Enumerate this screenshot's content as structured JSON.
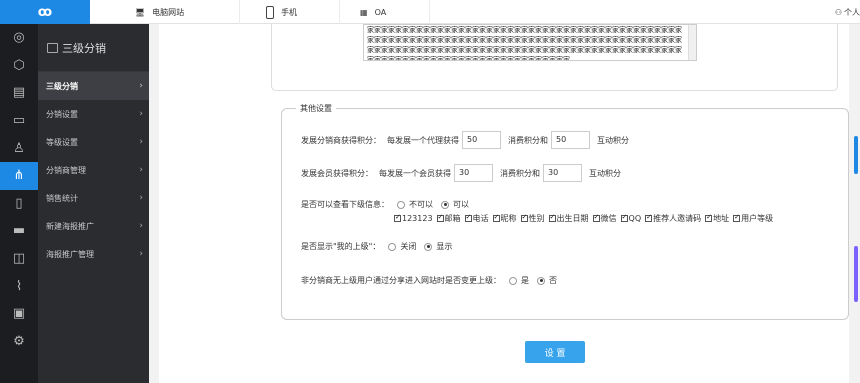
{
  "topbar": {
    "pc_label": "电脑网站",
    "phone_label": "手机",
    "oa_label": "OA",
    "user_label": "个人"
  },
  "sidebar": {
    "title": "三级分销",
    "items": [
      {
        "label": "三级分销"
      },
      {
        "label": "分销设置"
      },
      {
        "label": "等级设置"
      },
      {
        "label": "分销商管理"
      },
      {
        "label": "销售统计"
      },
      {
        "label": "新建海报推广"
      },
      {
        "label": "海报推广管理"
      }
    ]
  },
  "textarea_text": "家家家家家家家家家家家家家家家家家家家家家家家家家家家家家家家家家家家家家家家家家家家家家家家家家家家家家家家家家家家家家家家家家家家家家家家家家家家家家家家家家家家家家家家家家家家家家家家家家家家家家家家家家家家家家家家家家家家家家家家家家家家家家家家家家家家家家家家家家家家家家家家家家家家家家家家家家家家家家家家家家家家家",
  "settings": {
    "legend": "其他设置",
    "dist_points": {
      "label": "发展分销商获得积分：",
      "text1": "每发展一个代理获得",
      "value1": "50",
      "text2": "消费积分和",
      "value2": "50",
      "text3": "互动积分"
    },
    "member_points": {
      "label": "发展会员获得积分：",
      "text1": "每发展一个会员获得",
      "value1": "30",
      "text2": "消费积分和",
      "value2": "30",
      "text3": "互动积分"
    },
    "view_sub": {
      "label": "是否可以查看下级信息：",
      "opt_no": "不可以",
      "opt_yes": "可以",
      "fields": [
        "123123",
        "邮箱",
        "电话",
        "昵称",
        "性别",
        "出生日期",
        "微信",
        "QQ",
        "推荐人邀请码",
        "地址",
        "用户等级"
      ]
    },
    "show_parent": {
      "label": "是否显示\"我的上级\"：",
      "opt_off": "关闭",
      "opt_on": "显示"
    },
    "change_parent": {
      "label": "非分销商无上级用户通过分享进入网站时是否变更上级：",
      "opt_yes": "是",
      "opt_no": "否"
    },
    "submit_label": "设 置"
  },
  "colors": {
    "accent": "#1e88e5",
    "button": "#37a3ec"
  }
}
